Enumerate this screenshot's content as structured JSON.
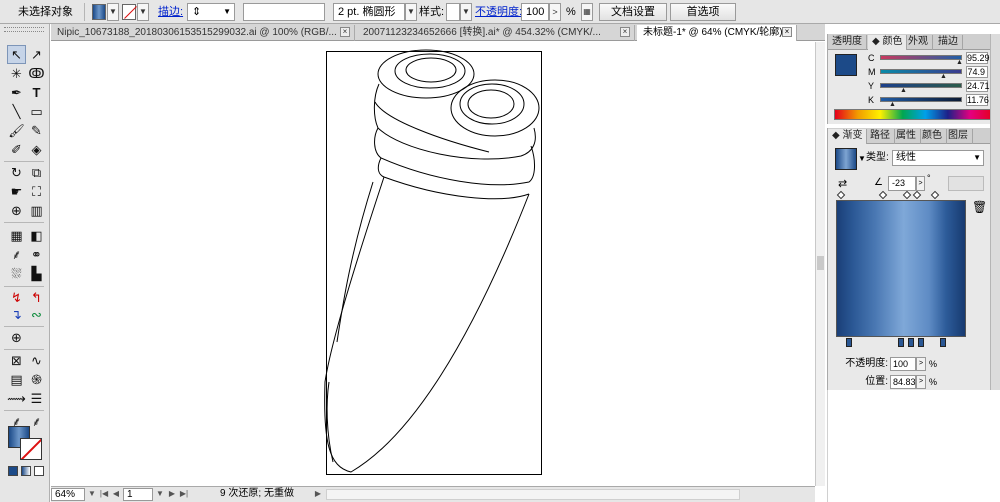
{
  "control_bar": {
    "selection_label": "未选择对象",
    "stroke_link": "描边:",
    "brush_value": "2 pt. 椭圆形",
    "style_label": "样式:",
    "opacity_link": "不透明度:",
    "opacity_value": "100",
    "opacity_unit": "%",
    "doc_setup_button": "文档设置",
    "preferences_button": "首选项",
    "fill_color": "#1c4a88",
    "stroke_none_color": "#dd1111"
  },
  "doc_tabs": [
    {
      "label": "Nipic_10673188_20180306153515299032.ai @ 100% (RGB/..."
    },
    {
      "label": "20071123234652666 [转换].ai* @ 454.32% (CMYK/..."
    },
    {
      "label": "未标题-1* @ 64% (CMYK/轮廓)"
    }
  ],
  "status_bar": {
    "zoom": "64%",
    "page": "1",
    "history": "9 次还原; 无重做"
  },
  "color_panel": {
    "tabs": [
      "透明度",
      "颜色",
      "外观",
      "描边"
    ],
    "active_tab": "颜色",
    "channels": [
      {
        "key": "C",
        "value": "95.29",
        "unit": "%"
      },
      {
        "key": "M",
        "value": "74.9",
        "unit": "%"
      },
      {
        "key": "Y",
        "value": "24.71",
        "unit": "%"
      },
      {
        "key": "K",
        "value": "11.76",
        "unit": "%"
      }
    ],
    "swatch_color": "#1c4a88"
  },
  "gradient_panel": {
    "tabs": [
      "渐变",
      "路径",
      "属性",
      "颜色",
      "图层"
    ],
    "active_tab": "渐变",
    "type_label": "类型:",
    "type_value": "线性",
    "angle": "-23",
    "angle_unit": "°",
    "opacity_label": "不透明度:",
    "opacity_value": "100",
    "opacity_unit": "%",
    "location_label": "位置:",
    "location_value": "84.83",
    "location_unit": "%",
    "stop_colors": [
      "#1a3f78",
      "#4a78b3",
      "#7fa8d8",
      "#5e8bc4",
      "#173a70"
    ]
  },
  "tools": [
    "selection-tool",
    "direct-selection-tool",
    "magic-wand-tool",
    "lasso-tool",
    "pen-tool",
    "type-tool",
    "line-segment-tool",
    "rectangle-tool",
    "paintbrush-tool",
    "pencil-tool",
    "blob-brush-tool",
    "eraser-tool",
    "rotate-tool",
    "scale-tool",
    "warp-tool",
    "free-transform-tool",
    "shape-builder-tool",
    "perspective-grid-tool",
    "mesh-tool",
    "gradient-tool",
    "eyedropper-tool",
    "blend-tool",
    "symbol-sprayer-tool",
    "column-graph-tool",
    "artboard-tool",
    "slice-tool",
    "hand-tool",
    "zoom-tool"
  ]
}
